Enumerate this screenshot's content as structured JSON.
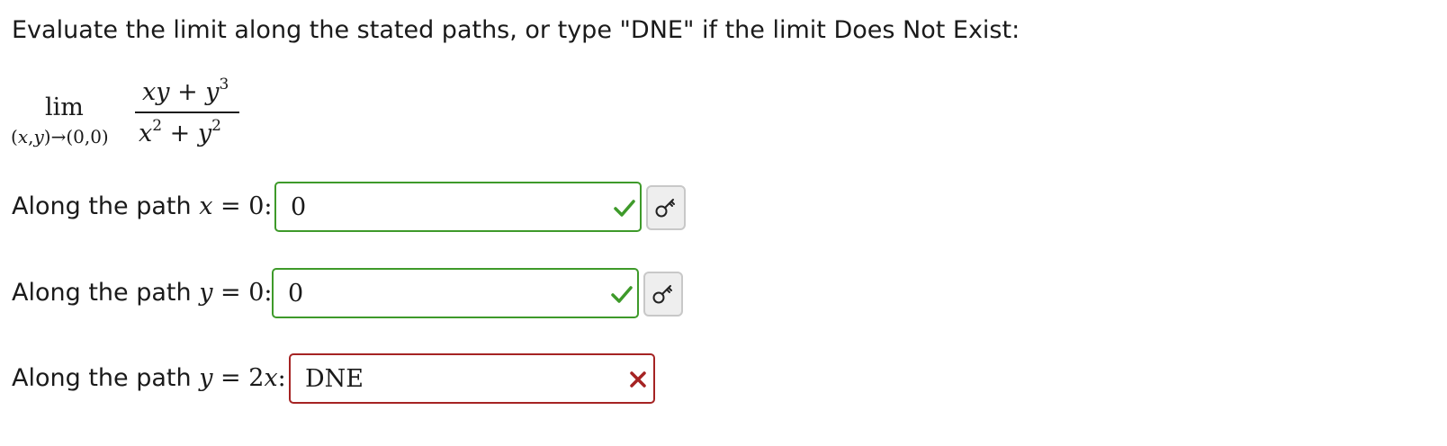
{
  "prompt": "Evaluate the limit along the stated paths, or type \"DNE\" if the limit Does Not Exist:",
  "limit": {
    "word": "lim",
    "subscript": "(x,y)→(0,0)",
    "numerator": "xy + y³",
    "denominator": "x² + y²"
  },
  "rows": [
    {
      "label_prefix": "Along the path",
      "path": "x = 0:",
      "value": "0",
      "status": "correct",
      "status_icon": "check-icon",
      "has_key_button": true
    },
    {
      "label_prefix": "Along the path",
      "path": "y = 0:",
      "value": "0",
      "status": "correct",
      "status_icon": "check-icon",
      "has_key_button": true
    },
    {
      "label_prefix": "Along the path",
      "path": "y = 2x:",
      "value": "DNE",
      "status": "incorrect",
      "status_icon": "x-icon",
      "has_key_button": false
    }
  ],
  "colors": {
    "correct": "#3e9a2a",
    "incorrect": "#a52323",
    "key_button_bg": "#eeeeee"
  }
}
